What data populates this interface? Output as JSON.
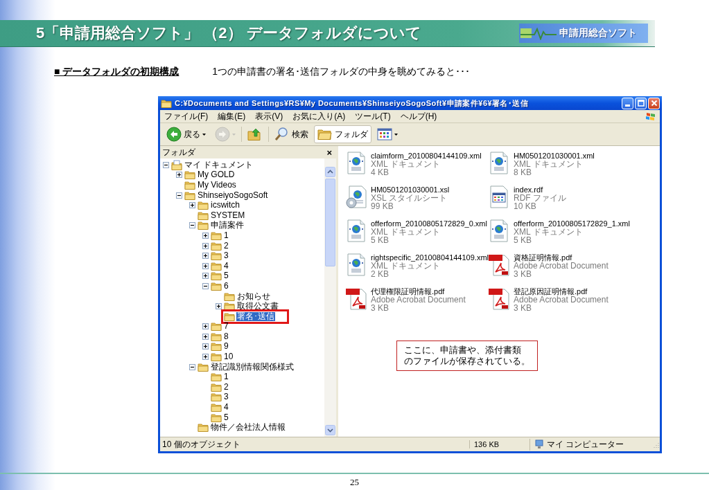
{
  "slide": {
    "title": "5「申請用総合ソフト」 （2） データフォルダについて",
    "logo": "申請用総合ソフト",
    "heading": "■ データフォルダの初期構成",
    "lead": "1つの申請書の署名･送信フォルダの中身を眺めてみると･･･",
    "page_number": "25"
  },
  "window": {
    "title": "C:¥Documents and Settings¥RS¥My Documents¥ShinseiyoSogoSoft¥申請案件¥6¥署名･送信",
    "menu": [
      "ファイル(F)",
      "編集(E)",
      "表示(V)",
      "お気に入り(A)",
      "ツール(T)",
      "ヘルプ(H)"
    ],
    "toolbar": [
      {
        "kind": "back",
        "label": "戻る",
        "disabled": false,
        "selected": false
      },
      {
        "kind": "forward",
        "disabled": true,
        "selected": false
      },
      {
        "kind": "up",
        "disabled": false,
        "selected": false
      },
      {
        "kind": "search",
        "label": "検索",
        "disabled": false,
        "selected": false
      },
      {
        "kind": "folders",
        "label": "フォルダ",
        "disabled": false,
        "selected": true
      },
      {
        "kind": "views",
        "disabled": false,
        "selected": false
      }
    ]
  },
  "folder_pane": {
    "title": "フォルダ",
    "close": "×",
    "tree": [
      {
        "label": "マイ ドキュメント",
        "kind": "documents",
        "expandable": true,
        "expanded": true,
        "selected": false,
        "children": [
          {
            "label": "My GOLD",
            "kind": "folder",
            "expandable": true,
            "expanded": false,
            "selected": false
          },
          {
            "label": "My Videos",
            "kind": "folder",
            "expandable": false,
            "expanded": false,
            "selected": false
          },
          {
            "label": "ShinseiyoSogoSoft",
            "kind": "folder",
            "expandable": true,
            "expanded": true,
            "selected": false,
            "children": [
              {
                "label": "icswitch",
                "kind": "folder",
                "expandable": true,
                "expanded": false,
                "selected": false
              },
              {
                "label": "SYSTEM",
                "kind": "folder",
                "expandable": false,
                "expanded": false,
                "selected": false
              },
              {
                "label": "申請案件",
                "kind": "folder",
                "expandable": true,
                "expanded": true,
                "selected": false,
                "children": [
                  {
                    "label": "1",
                    "kind": "folder",
                    "expandable": true,
                    "expanded": false,
                    "selected": false
                  },
                  {
                    "label": "2",
                    "kind": "folder",
                    "expandable": true,
                    "expanded": false,
                    "selected": false
                  },
                  {
                    "label": "3",
                    "kind": "folder",
                    "expandable": true,
                    "expanded": false,
                    "selected": false
                  },
                  {
                    "label": "4",
                    "kind": "folder",
                    "expandable": true,
                    "expanded": false,
                    "selected": false
                  },
                  {
                    "label": "5",
                    "kind": "folder",
                    "expandable": true,
                    "expanded": false,
                    "selected": false
                  },
                  {
                    "label": "6",
                    "kind": "folder",
                    "expandable": true,
                    "expanded": true,
                    "selected": false,
                    "children": [
                      {
                        "label": "お知らせ",
                        "kind": "folder",
                        "expandable": false,
                        "expanded": false,
                        "selected": false
                      },
                      {
                        "label": "取得公文書",
                        "kind": "folder",
                        "expandable": true,
                        "expanded": false,
                        "selected": false
                      },
                      {
                        "label": "署名･送信",
                        "kind": "folder",
                        "expandable": false,
                        "expanded": false,
                        "selected": true
                      }
                    ]
                  },
                  {
                    "label": "7",
                    "kind": "folder",
                    "expandable": true,
                    "expanded": false,
                    "selected": false
                  },
                  {
                    "label": "8",
                    "kind": "folder",
                    "expandable": true,
                    "expanded": false,
                    "selected": false
                  },
                  {
                    "label": "9",
                    "kind": "folder",
                    "expandable": true,
                    "expanded": false,
                    "selected": false
                  },
                  {
                    "label": "10",
                    "kind": "folder",
                    "expandable": true,
                    "expanded": false,
                    "selected": false
                  }
                ]
              },
              {
                "label": "登記識別情報関係様式",
                "kind": "folder",
                "expandable": true,
                "expanded": true,
                "selected": false,
                "children": [
                  {
                    "label": "1",
                    "kind": "folder",
                    "expandable": false,
                    "expanded": false,
                    "selected": false
                  },
                  {
                    "label": "2",
                    "kind": "folder",
                    "expandable": false,
                    "expanded": false,
                    "selected": false
                  },
                  {
                    "label": "3",
                    "kind": "folder",
                    "expandable": false,
                    "expanded": false,
                    "selected": false
                  },
                  {
                    "label": "4",
                    "kind": "folder",
                    "expandable": false,
                    "expanded": false,
                    "selected": false
                  },
                  {
                    "label": "5",
                    "kind": "folder",
                    "expandable": false,
                    "expanded": false,
                    "selected": false
                  }
                ]
              },
              {
                "label": "物件／会社法人情報",
                "kind": "folder",
                "expandable": false,
                "expanded": false,
                "selected": false
              }
            ]
          }
        ]
      }
    ]
  },
  "files": [
    {
      "kind": "xml",
      "name": "claimform_20100804144109.xml",
      "type": "XML ドキュメント",
      "size": "4 KB"
    },
    {
      "kind": "xml",
      "name": "HM0501201030001.xml",
      "type": "XML ドキュメント",
      "size": "8 KB"
    },
    {
      "kind": "xsl",
      "name": "HM0501201030001.xsl",
      "type": "XSL スタイルシート",
      "size": "99 KB"
    },
    {
      "kind": "rdf",
      "name": "index.rdf",
      "type": "RDF ファイル",
      "size": "10 KB"
    },
    {
      "kind": "xml",
      "name": "offerform_20100805172829_0.xml",
      "type": "XML ドキュメント",
      "size": "5 KB"
    },
    {
      "kind": "xml",
      "name": "offerform_20100805172829_1.xml",
      "type": "XML ドキュメント",
      "size": "5 KB"
    },
    {
      "kind": "xml",
      "name": "rightspecific_20100804144109.xml",
      "type": "XML ドキュメント",
      "size": "2 KB"
    },
    {
      "kind": "pdf",
      "name": "資格証明情報.pdf",
      "type": "Adobe Acrobat Document",
      "size": "3 KB"
    },
    {
      "kind": "pdf",
      "name": "代理権限証明情報.pdf",
      "type": "Adobe Acrobat Document",
      "size": "3 KB"
    },
    {
      "kind": "pdf",
      "name": "登記原因証明情報.pdf",
      "type": "Adobe Acrobat Document",
      "size": "3 KB"
    }
  ],
  "callout": {
    "lines": [
      "ここに、申請書や、添付書類",
      "のファイルが保存されている。"
    ]
  },
  "status_bar": {
    "count": "10 個のオブジェクト",
    "size": "136 KB",
    "zone": "マイ コンピューター"
  }
}
